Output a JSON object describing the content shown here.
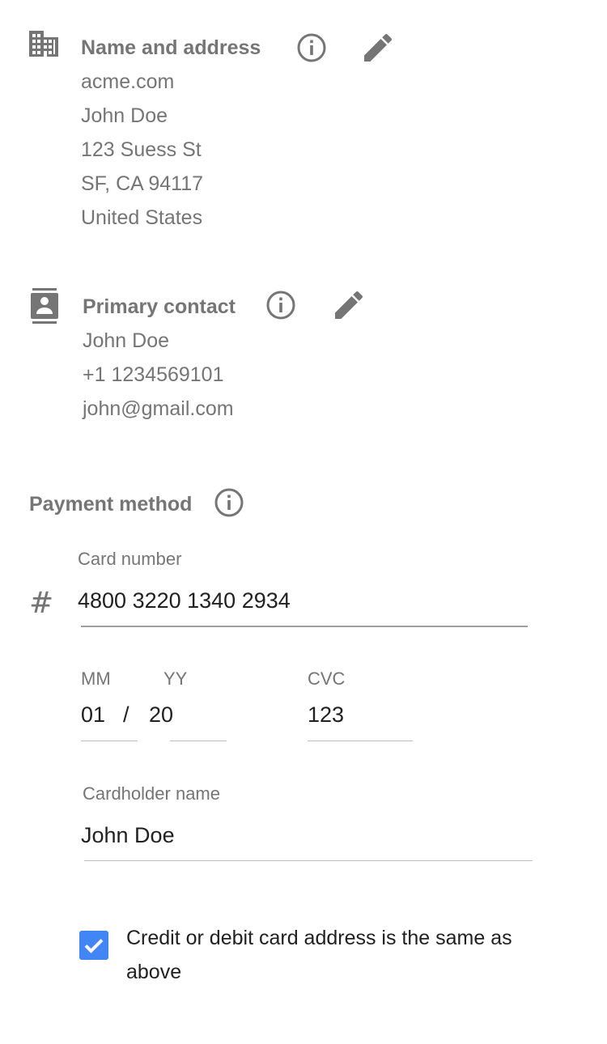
{
  "name_address": {
    "title": "Name and address",
    "lines": [
      "acme.com",
      "John Doe",
      "123 Suess St",
      "SF, CA 94117",
      "United States"
    ],
    "icons": {
      "section": "building-icon",
      "info": "info-icon",
      "edit": "pencil-icon"
    }
  },
  "primary_contact": {
    "title": "Primary contact",
    "lines": [
      "John Doe",
      "+1 1234569101",
      "john@gmail.com"
    ],
    "icons": {
      "section": "contact-card-icon",
      "info": "info-icon",
      "edit": "pencil-icon"
    }
  },
  "payment": {
    "title": "Payment method",
    "info_icon": "info-icon",
    "card_number": {
      "label": "Card number",
      "value": "4800 3220 1340 2934",
      "icon": "hash-icon",
      "icon_glyph": "#"
    },
    "expiry": {
      "month_label": "MM",
      "month_value": "01",
      "separator": "/",
      "year_label": "YY",
      "year_value": "20"
    },
    "cvc": {
      "label": "CVC",
      "value": "123"
    },
    "cardholder": {
      "label": "Cardholder name",
      "value": "John Doe"
    },
    "same_address": {
      "label": "Credit or debit card address is the same as above",
      "checked": true
    }
  },
  "colors": {
    "text_secondary": "#757575",
    "text_primary": "#212121",
    "checkbox": "#4285f4",
    "underline": "#9e9e9e"
  }
}
